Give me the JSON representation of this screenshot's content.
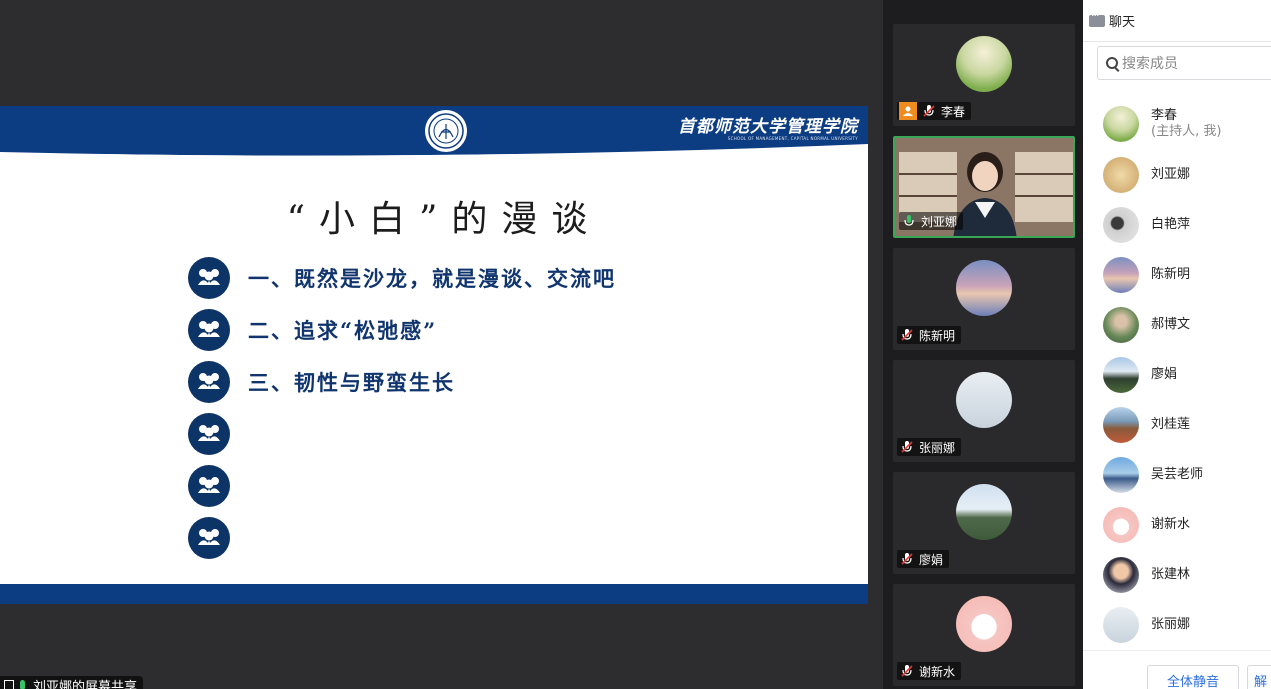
{
  "slide": {
    "school_cn": "首都师范大学管理学院",
    "school_en": "SCHOOL OF MANAGEMENT, CAPITAL NORMAL UNIVERSITY",
    "title": "“小白”的漫谈",
    "items": [
      "一、既然是沙龙，就是漫谈、交流吧",
      "二、追求“松弛感”",
      "三、韧性与野蛮生长",
      "",
      "",
      ""
    ]
  },
  "share_tag": "刘亚娜的屏幕共享",
  "tiles": [
    {
      "name": "李春",
      "host": true,
      "muted": true,
      "avatar": "meadow-avatar"
    },
    {
      "name": "刘亚娜",
      "host": false,
      "muted": false,
      "camera": true
    },
    {
      "name": "陈新明",
      "host": false,
      "muted": true,
      "avatar": "sky-avatar"
    },
    {
      "name": "张丽娜",
      "host": false,
      "muted": true,
      "avatar": "tower-avatar"
    },
    {
      "name": "廖娟",
      "host": false,
      "muted": true,
      "avatar": "landscape-avatar"
    },
    {
      "name": "谢新水",
      "host": false,
      "muted": true,
      "avatar": "cartoon-avatar"
    }
  ],
  "panel": {
    "title": "聊天",
    "search_placeholder": "搜索成员",
    "members": [
      {
        "name": "李春",
        "role": "(主持人, 我)"
      },
      {
        "name": "刘亚娜"
      },
      {
        "name": "白艳萍"
      },
      {
        "name": "陈新明"
      },
      {
        "name": "郝博文"
      },
      {
        "name": "廖娟"
      },
      {
        "name": "刘桂莲"
      },
      {
        "name": "吴芸老师"
      },
      {
        "name": "谢新水"
      },
      {
        "name": "张建林"
      },
      {
        "name": "张丽娜"
      }
    ],
    "mute_all": "全体静音",
    "unmute_all": "解"
  },
  "colors": {
    "navy": "#0c3c82",
    "text_navy": "#10356e",
    "link": "#2d6fe0",
    "active": "#3aa757"
  }
}
